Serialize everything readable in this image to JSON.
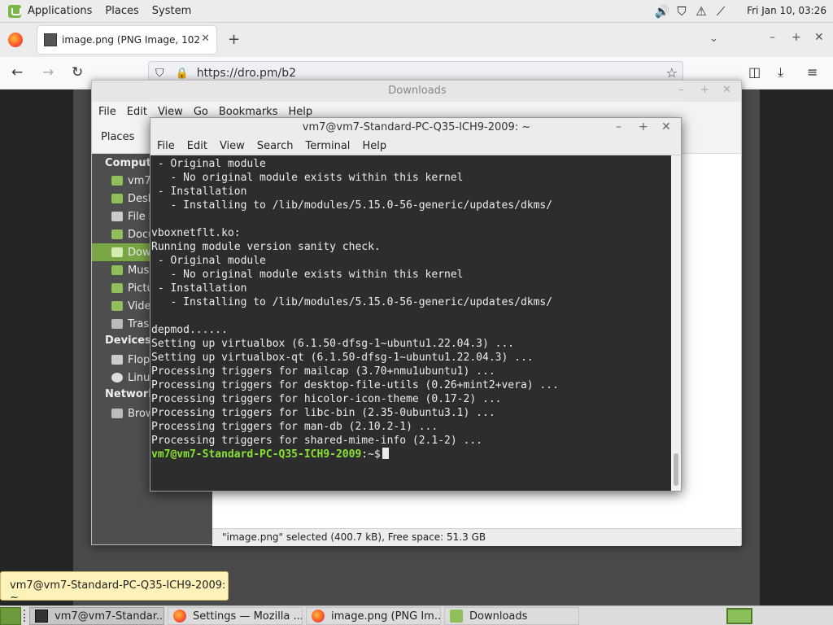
{
  "top_panel": {
    "menus": [
      "Applications",
      "Places",
      "System"
    ],
    "clock": "Fri Jan 10, 03:26"
  },
  "browser": {
    "tab_title": "image.png (PNG Image, 102",
    "url": "https://dro.pm/b2"
  },
  "file_manager": {
    "title": "Downloads",
    "menus": [
      "File",
      "Edit",
      "View",
      "Go",
      "Bookmarks",
      "Help"
    ],
    "places_label": "Places",
    "sections": {
      "computer": "Compute",
      "devices": "Devices",
      "network": "Network"
    },
    "items": {
      "home": "vm7",
      "desktop": "Desk",
      "filesystem": "File S",
      "documents": "Docu",
      "downloads": "Dow",
      "music": "Mus",
      "pictures": "Pictu",
      "videos": "Vide",
      "trash": "Tras",
      "floppy": "Flop",
      "linux": "Linu",
      "browse": "Brow"
    },
    "status": "\"image.png\" selected (400.7 kB), Free space: 51.3 GB"
  },
  "terminal": {
    "title": "vm7@vm7-Standard-PC-Q35-ICH9-2009: ~",
    "menus": [
      "File",
      "Edit",
      "View",
      "Search",
      "Terminal",
      "Help"
    ],
    "lines": [
      " - Original module",
      "   - No original module exists within this kernel",
      " - Installation",
      "   - Installing to /lib/modules/5.15.0-56-generic/updates/dkms/",
      "",
      "vboxnetflt.ko:",
      "Running module version sanity check.",
      " - Original module",
      "   - No original module exists within this kernel",
      " - Installation",
      "   - Installing to /lib/modules/5.15.0-56-generic/updates/dkms/",
      "",
      "depmod......",
      "Setting up virtualbox (6.1.50-dfsg-1~ubuntu1.22.04.3) ...",
      "Setting up virtualbox-qt (6.1.50-dfsg-1~ubuntu1.22.04.3) ...",
      "Processing triggers for mailcap (3.70+nmu1ubuntu1) ...",
      "Processing triggers for desktop-file-utils (0.26+mint2+vera) ...",
      "Processing triggers for hicolor-icon-theme (0.17-2) ...",
      "Processing triggers for libc-bin (2.35-0ubuntu3.1) ...",
      "Processing triggers for man-db (2.10.2-1) ...",
      "Processing triggers for shared-mime-info (2.1-2) ..."
    ],
    "prompt_user": "vm7@vm7-Standard-PC-Q35-ICH9-2009",
    "prompt_suffix": ":~$"
  },
  "tooltip": "vm7@vm7-Standard-PC-Q35-ICH9-2009: ~",
  "taskbar": {
    "tasks": [
      "vm7@vm7-Standar...",
      "Settings — Mozilla ...",
      "image.png (PNG Im...",
      "Downloads"
    ]
  },
  "colors": {
    "mint_green": "#7aa545",
    "prompt_green": "#8ae234",
    "terminal_bg": "#2d2d2d"
  }
}
